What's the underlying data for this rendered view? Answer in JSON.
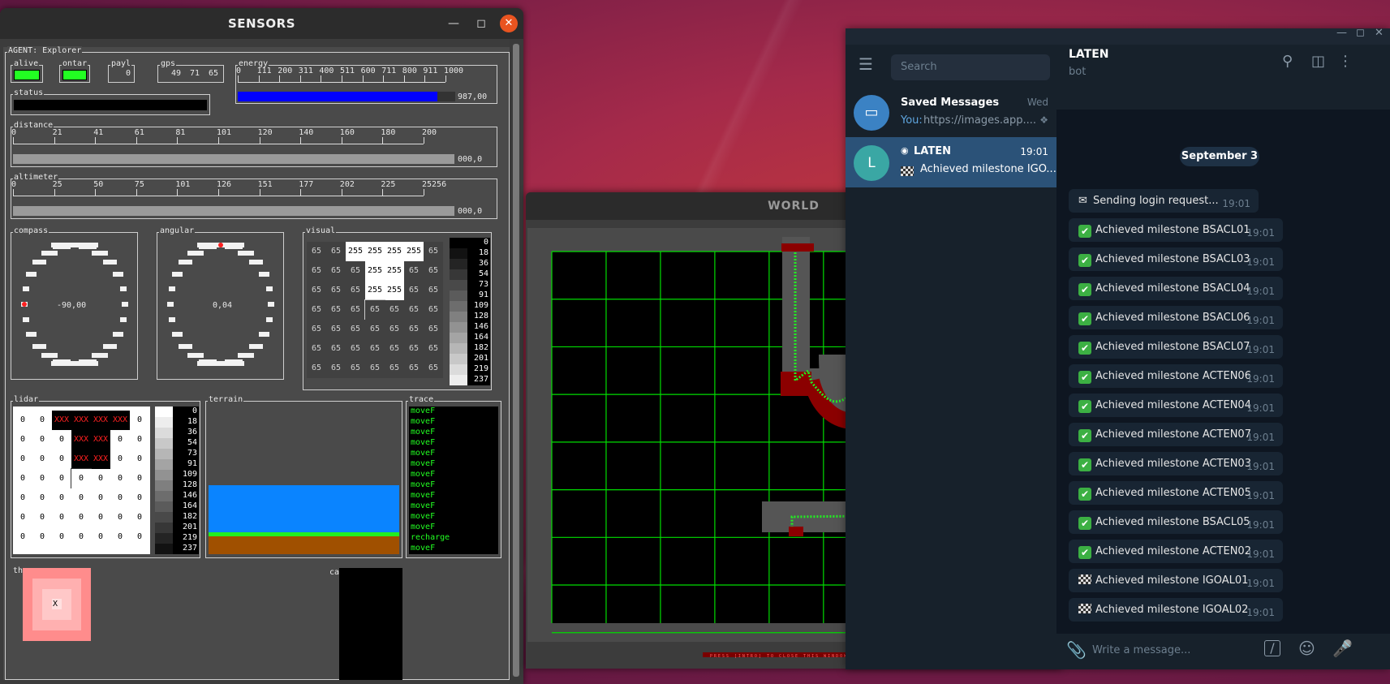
{
  "sensors": {
    "title": "SENSORS",
    "agent_label": "AGENT: Explorer",
    "alive": "alive",
    "ontar": "ontar",
    "payl": "payl",
    "payl_value": "0",
    "gps": "gps",
    "gps_values": [
      "49",
      "71",
      "65"
    ],
    "energy": "energy",
    "energy_ticks": [
      "0",
      "111",
      "200",
      "311",
      "400",
      "511",
      "600",
      "711",
      "800",
      "911",
      "1000"
    ],
    "energy_value": "987,00",
    "energy_fraction": 0.987,
    "status": "status",
    "distance": "distance",
    "distance_ticks": [
      "0",
      "21",
      "41",
      "61",
      "81",
      "101",
      "120",
      "140",
      "160",
      "180",
      "200"
    ],
    "distance_value": "000,0",
    "altimeter": "altimeter",
    "altimeter_ticks": [
      "0",
      "25",
      "50",
      "75",
      "101",
      "126",
      "151",
      "177",
      "202",
      "225",
      "25256"
    ],
    "altimeter_value": "000,0",
    "compass": "compass",
    "compass_value": "-90,00",
    "angular": "angular",
    "angular_value": "0,04",
    "visual": "visual",
    "visual_grid": [
      [
        "65",
        "65",
        "255",
        "255",
        "255",
        "255",
        "65"
      ],
      [
        "65",
        "65",
        "65",
        "255",
        "255",
        "65",
        "65"
      ],
      [
        "65",
        "65",
        "65",
        "255",
        "255",
        "65",
        "65"
      ],
      [
        "65",
        "65",
        "65",
        "65",
        "65",
        "65",
        "65"
      ],
      [
        "65",
        "65",
        "65",
        "65",
        "65",
        "65",
        "65"
      ],
      [
        "65",
        "65",
        "65",
        "65",
        "65",
        "65",
        "65"
      ],
      [
        "65",
        "65",
        "65",
        "65",
        "65",
        "65",
        "65"
      ]
    ],
    "visual_scale": [
      "0",
      "18",
      "36",
      "54",
      "73",
      "91",
      "109",
      "128",
      "146",
      "164",
      "182",
      "201",
      "219",
      "237"
    ],
    "lidar": "lidar",
    "lidar_grid": [
      [
        "0",
        "0",
        "XXX",
        "XXX",
        "XXX",
        "XXX",
        "0"
      ],
      [
        "0",
        "0",
        "0",
        "XXX",
        "XXX",
        "0",
        "0"
      ],
      [
        "0",
        "0",
        "0",
        "XXX",
        "XXX",
        "0",
        "0"
      ],
      [
        "0",
        "0",
        "0",
        "0",
        "0",
        "0",
        "0"
      ],
      [
        "0",
        "0",
        "0",
        "0",
        "0",
        "0",
        "0"
      ],
      [
        "0",
        "0",
        "0",
        "0",
        "0",
        "0",
        "0"
      ],
      [
        "0",
        "0",
        "0",
        "0",
        "0",
        "0",
        "0"
      ]
    ],
    "lidar_scale": [
      "0",
      "18",
      "36",
      "54",
      "73",
      "91",
      "109",
      "128",
      "146",
      "164",
      "182",
      "201",
      "219",
      "237"
    ],
    "terrain": "terrain",
    "trace": "trace",
    "trace_lines": [
      "moveF",
      "moveF",
      "moveF",
      "moveF",
      "moveF",
      "moveF",
      "moveF",
      "moveF",
      "moveF",
      "moveF",
      "moveF",
      "moveF",
      "recharge",
      "moveF"
    ],
    "th_label": "th",
    "th_x": "X",
    "ca_label": "ca"
  },
  "world": {
    "title": "WORLD",
    "footer": "PRESS [INTRO] TO CLOSE THIS WINDOW"
  },
  "telegram": {
    "search_placeholder": "Search",
    "chat_title": "LATEN",
    "chat_subtitle": "bot",
    "chats": [
      {
        "name": "Saved Messages",
        "time": "Wed",
        "preview_prefix": "You:",
        "preview": " https://images.app...."
      },
      {
        "name": "LATEN",
        "time": "19:01",
        "preview": "Achieved milestone IGO...",
        "avatar": "L"
      }
    ],
    "date_chip": "September 3",
    "messages": [
      {
        "kind": "mail",
        "text": "Sending login request...",
        "time": "19:01"
      },
      {
        "kind": "check",
        "text": "Achieved milestone BSACL01",
        "time": "19:01"
      },
      {
        "kind": "check",
        "text": "Achieved milestone BSACL03",
        "time": "19:01"
      },
      {
        "kind": "check",
        "text": "Achieved milestone BSACL04",
        "time": "19:01"
      },
      {
        "kind": "check",
        "text": "Achieved milestone BSACL06",
        "time": "19:01"
      },
      {
        "kind": "check",
        "text": "Achieved milestone BSACL07",
        "time": "19:01"
      },
      {
        "kind": "check",
        "text": "Achieved milestone ACTEN06",
        "time": "19:01"
      },
      {
        "kind": "check",
        "text": "Achieved milestone ACTEN04",
        "time": "19:01"
      },
      {
        "kind": "check",
        "text": "Achieved milestone ACTEN07",
        "time": "19:01"
      },
      {
        "kind": "check",
        "text": "Achieved milestone ACTEN03",
        "time": "19:01"
      },
      {
        "kind": "check",
        "text": "Achieved milestone ACTEN05",
        "time": "19:01"
      },
      {
        "kind": "check",
        "text": "Achieved milestone BSACL05",
        "time": "19:01"
      },
      {
        "kind": "check",
        "text": "Achieved milestone ACTEN02",
        "time": "19:01"
      },
      {
        "kind": "flag",
        "text": "Achieved milestone IGOAL01",
        "time": "19:01"
      },
      {
        "kind": "flag",
        "text": "Achieved milestone IGOAL02",
        "time": "19:01"
      }
    ],
    "compose_placeholder": "Write a message..."
  },
  "colors": {
    "accent_orange": "#e95420",
    "energy_blue": "#0000ff",
    "led_green": "#22ff22",
    "track_red": "#8b0000",
    "grid_green": "#00dd00",
    "tg_selected": "#2b5278"
  }
}
